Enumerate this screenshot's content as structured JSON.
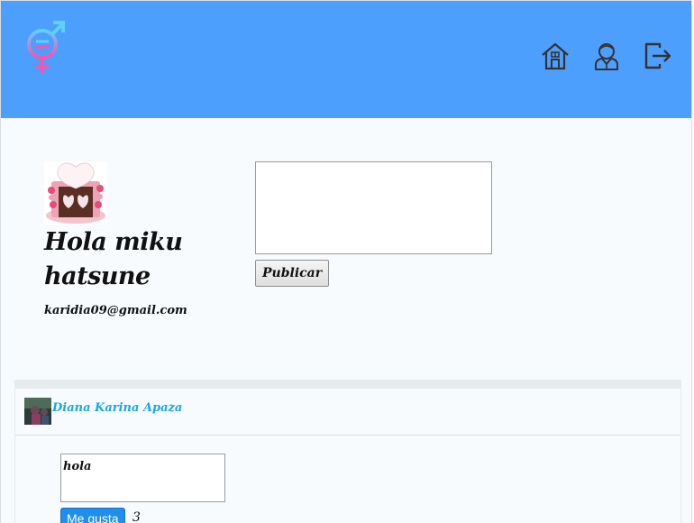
{
  "header": {
    "logo_icon": "gender-symbol-logo",
    "nav": [
      {
        "icon": "home-icon"
      },
      {
        "icon": "user-profile-icon"
      },
      {
        "icon": "logout-icon"
      }
    ],
    "background_color": "#4d9ffd"
  },
  "profile": {
    "name": "Hola miku hatsune",
    "email": "karidia09@gmail.com"
  },
  "composer": {
    "value": "",
    "publish_label": "Publicar"
  },
  "feed": {
    "posts": [
      {
        "author": "Diana Karina Apaza",
        "content": "hola",
        "like_label": "Me gusta",
        "like_count": "3"
      }
    ]
  },
  "colors": {
    "accent": "#4d9ffd",
    "author_link": "#1aa7e2",
    "like_button": "#1e8fee"
  }
}
